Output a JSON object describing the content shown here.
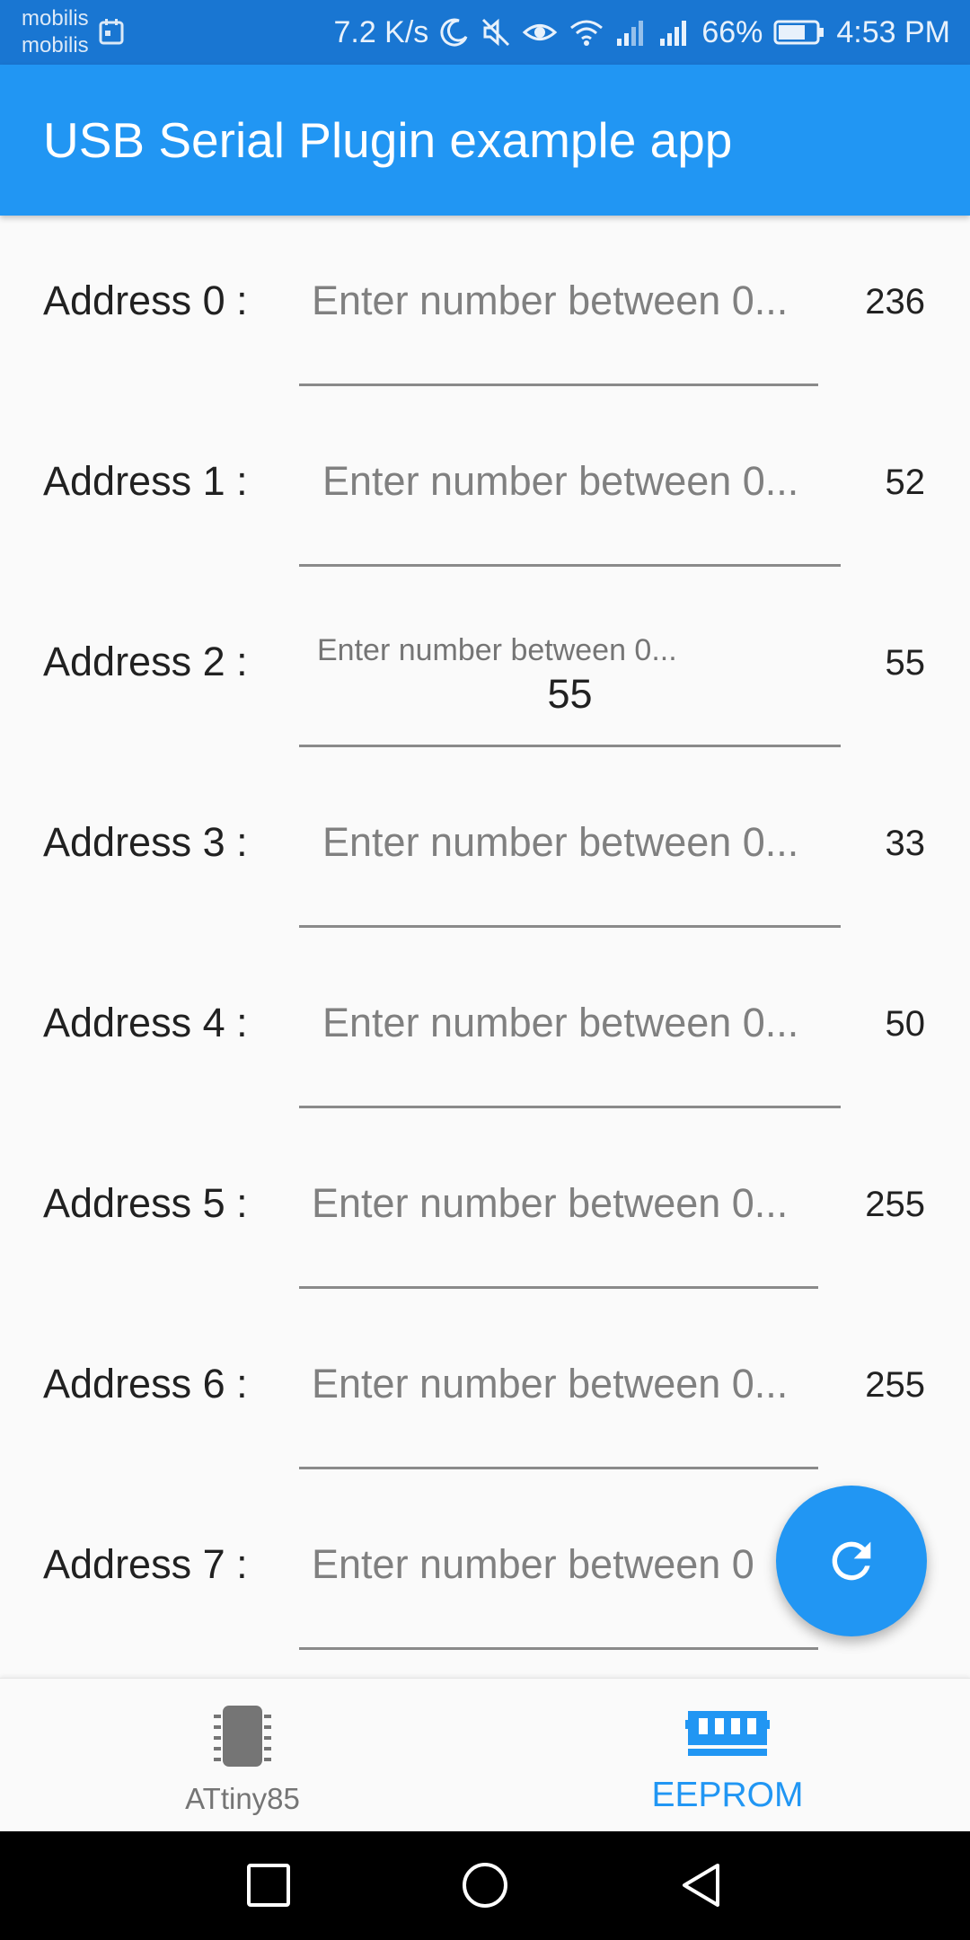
{
  "status_bar": {
    "carrier_1": "mobilis",
    "carrier_2": "mobilis",
    "net_speed": "7.2 K/s",
    "battery": "66%",
    "time": "4:53 PM"
  },
  "app_bar": {
    "title": "USB Serial Plugin example app"
  },
  "rows": [
    {
      "label": "Address 0 :",
      "placeholder": "Enter number between 0...",
      "input": "",
      "value": "236"
    },
    {
      "label": "Address 1 :",
      "placeholder": "Enter number between 0...",
      "input": "",
      "value": "52"
    },
    {
      "label": "Address 2 :",
      "placeholder": "Enter number between 0...",
      "input": "55",
      "value": "55"
    },
    {
      "label": "Address 3 :",
      "placeholder": "Enter number between 0...",
      "input": "",
      "value": "33"
    },
    {
      "label": "Address 4 :",
      "placeholder": "Enter number between 0...",
      "input": "",
      "value": "50"
    },
    {
      "label": "Address 5 :",
      "placeholder": "Enter number between 0...",
      "input": "",
      "value": "255"
    },
    {
      "label": "Address 6 :",
      "placeholder": "Enter number between 0...",
      "input": "",
      "value": "255"
    },
    {
      "label": "Address 7 :",
      "placeholder": "Enter number between 0",
      "input": "",
      "value": ""
    }
  ],
  "fab": {
    "icon": "refresh-icon"
  },
  "bottom_nav": {
    "items": [
      {
        "label": "ATtiny85",
        "icon": "chip-icon",
        "active": false
      },
      {
        "label": "EEPROM",
        "icon": "memory-icon",
        "active": true
      }
    ]
  },
  "colors": {
    "primary": "#2196f3",
    "status_bar": "#1976d2",
    "text": "#212121",
    "hint": "#808080"
  }
}
